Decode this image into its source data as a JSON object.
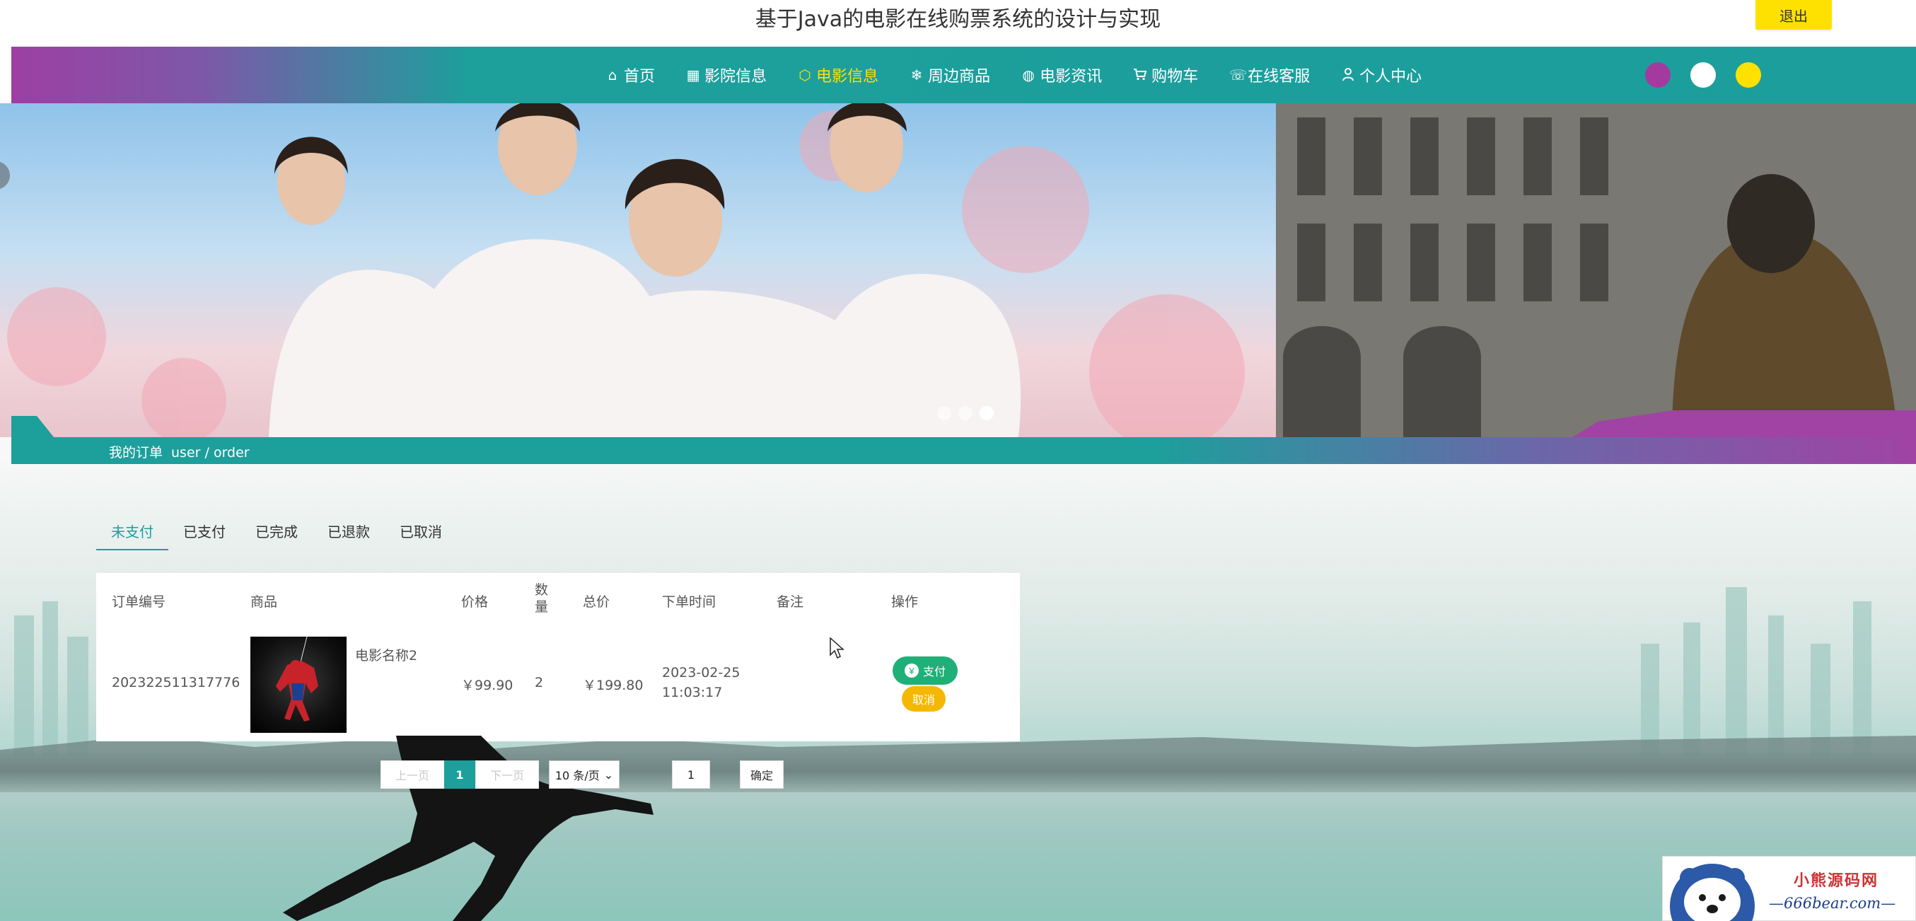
{
  "header": {
    "site_title": "基于Java的电影在线购票系统的设计与实现",
    "logout_label": "退出"
  },
  "nav": {
    "items": [
      {
        "label": "首页",
        "icon": "home-icon"
      },
      {
        "label": "影院信息",
        "icon": "grid-icon"
      },
      {
        "label": "电影信息",
        "icon": "cube-icon",
        "active": true
      },
      {
        "label": "周边商品",
        "icon": "snowflake-icon"
      },
      {
        "label": "电影资讯",
        "icon": "palette-icon"
      },
      {
        "label": "购物车",
        "icon": "cart-icon"
      },
      {
        "label": "在线客服",
        "icon": "headset-icon"
      },
      {
        "label": "个人中心",
        "icon": "user-icon"
      }
    ],
    "theme_colors": [
      "#a43aa0",
      "#ffffff",
      "#ffe100"
    ],
    "accent_color": "#1d9f9c",
    "active_color": "#ffe100"
  },
  "banner": {
    "dot_count": 3,
    "active_dot": 2
  },
  "breadcrumb": {
    "title": "我的订单",
    "path": "user / order"
  },
  "order_tabs": [
    "未支付",
    "已支付",
    "已完成",
    "已退款",
    "已取消"
  ],
  "table": {
    "headers": [
      "订单编号",
      "商品",
      "价格",
      "数量",
      "总价",
      "下单时间",
      "备注",
      "操作"
    ],
    "rows": [
      {
        "order_no": "202322511317776",
        "product": "电影名称2",
        "price": "￥99.90",
        "quantity": "2",
        "total": "￥199.80",
        "time_date": "2023-02-25",
        "time_clock": "11:03:17",
        "remark": "",
        "pay_label": "支付",
        "cancel_label": "取消"
      }
    ]
  },
  "pagination": {
    "prev_label": "上一页",
    "current_page": "1",
    "next_label": "下一页",
    "page_size": "10 条/页",
    "jump_value": "1",
    "confirm_label": "确定"
  },
  "watermark": {
    "title": "小熊源码网",
    "url": "—666bear.com—"
  }
}
